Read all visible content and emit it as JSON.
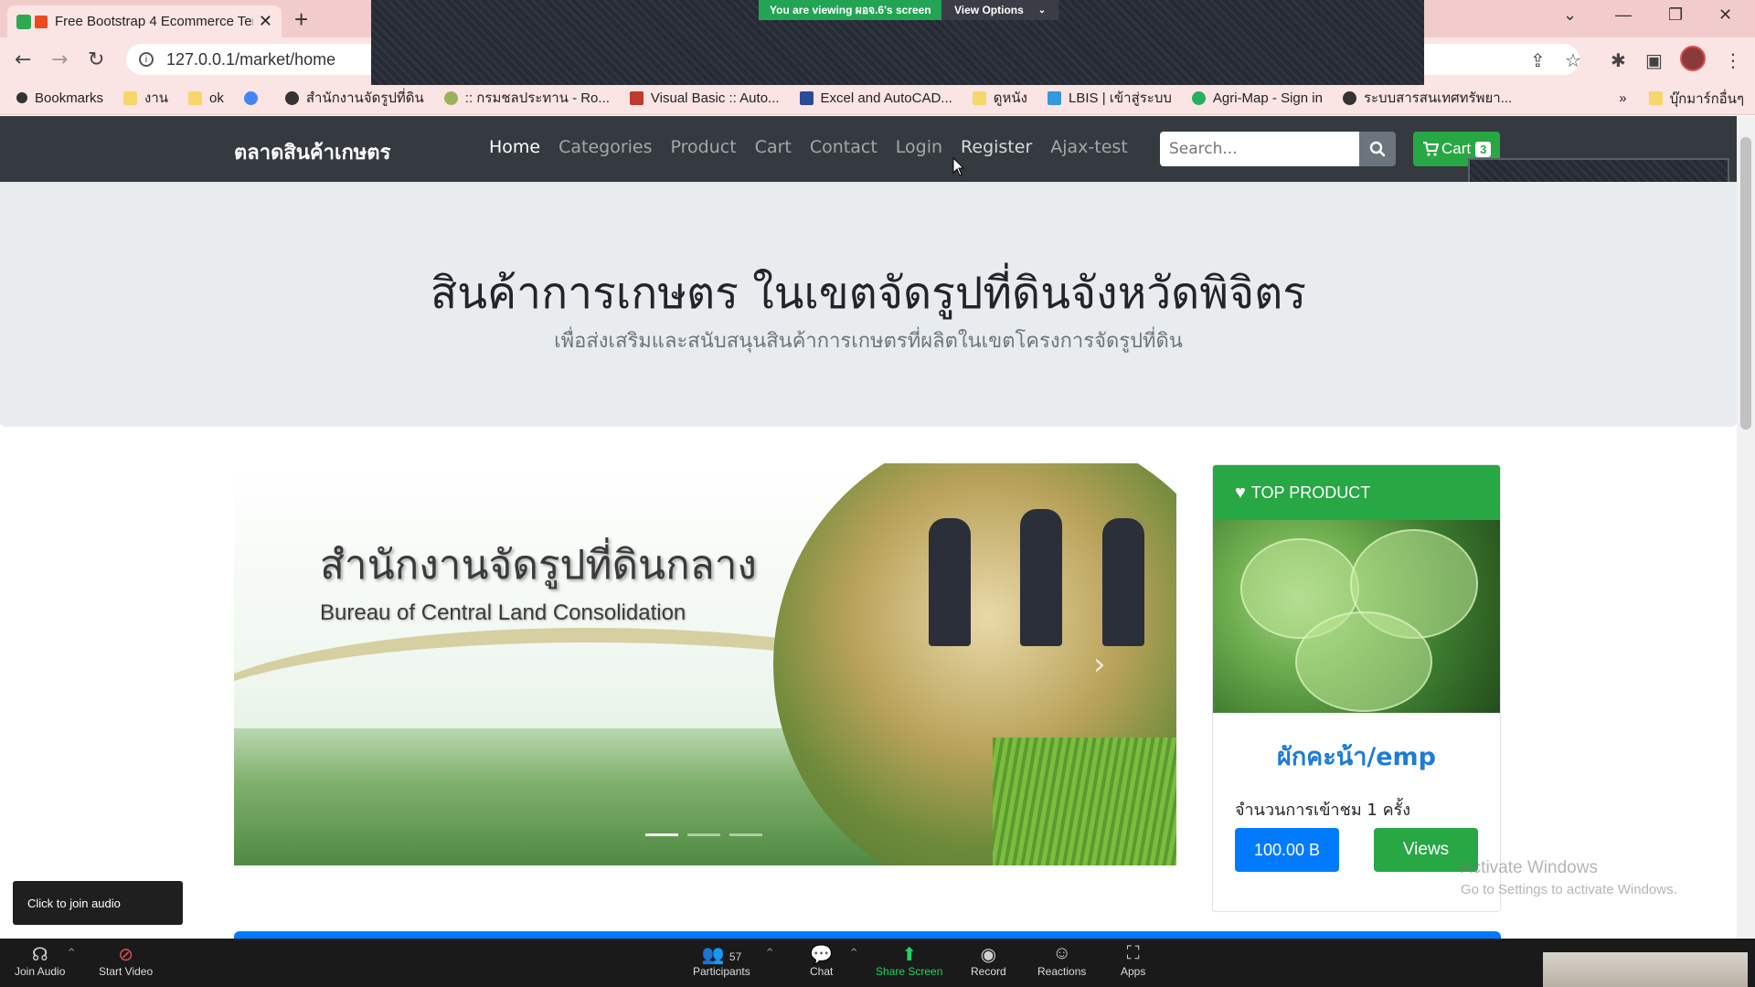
{
  "browser": {
    "tab_title": "Free Bootstrap 4 Ecommerce Template",
    "tab_close": "✕",
    "new_tab": "+",
    "url": "127.0.0.1/market/home",
    "bookmarks": [
      {
        "label": "Bookmarks",
        "color": "#333333"
      },
      {
        "label": "งาน",
        "color": "#f7d66a"
      },
      {
        "label": "ok",
        "color": "#f7d66a"
      },
      {
        "label": "",
        "color": "#4285f4"
      },
      {
        "label": "สำนักงานจัดรูปที่ดิน",
        "color": "#333333"
      },
      {
        "label": ":: กรมชลประทาน - Ro...",
        "color": "#9ab35a"
      },
      {
        "label": "Visual Basic :: Auto...",
        "color": "#c0392b"
      },
      {
        "label": "Excel and AutoCAD...",
        "color": "#2b4a9a"
      },
      {
        "label": "ดูหนัง",
        "color": "#f7d66a"
      },
      {
        "label": "LBIS | เข้าสู่ระบบ",
        "color": "#3498db"
      },
      {
        "label": "Agri-Map - Sign in",
        "color": "#27ae60"
      },
      {
        "label": "ระบบสารสนเทศทรัพยา...",
        "color": "#333333"
      }
    ],
    "bookmarks_more": "»",
    "bookmarks_other": "บุ๊กมาร์กอื่นๆ"
  },
  "zoom_share": {
    "viewing_text": "You are viewing ผอจ.6's screen",
    "view_options": "View Options"
  },
  "site": {
    "brand": "ตลาดสินค้าเกษตร",
    "nav": [
      {
        "label": "Home",
        "active": true
      },
      {
        "label": "Categories",
        "active": false
      },
      {
        "label": "Product",
        "active": false
      },
      {
        "label": "Cart",
        "active": false
      },
      {
        "label": "Contact",
        "active": false
      },
      {
        "label": "Login",
        "active": false
      },
      {
        "label": "Register",
        "active": false
      },
      {
        "label": "Ajax-test",
        "active": false
      }
    ],
    "search_placeholder": "Search...",
    "cart_label": "Cart",
    "cart_count": "3"
  },
  "jumbotron": {
    "title": "สินค้าการเกษตร ในเขตจัดรูปที่ดินจังหวัดพิจิตร",
    "subtitle": "เพื่อส่งเสริมและสนับสนุนสินค้าการเกษตรที่ผลิตในเขตโครงการจัดรูปที่ดิน"
  },
  "carousel": {
    "text_th": "สำนักงานจัดรูปที่ดินกลาง",
    "text_en": "Bureau of Central Land Consolidation",
    "active_slide": 1,
    "slide_count": 3
  },
  "top_product": {
    "header": "TOP PRODUCT",
    "name": "ผักคะน้า/emp",
    "views_text": "จำนวนการเข้าชม 1 ครั้ง",
    "price": "100.00 B",
    "views_button": "Views"
  },
  "windows_notice": {
    "line1": "Activate Windows",
    "line2": "Go to Settings to activate Windows."
  },
  "zoom_toolbar": {
    "tooltip": "Click to join audio",
    "items": [
      {
        "label": "Join Audio",
        "icon": "headphones-icon"
      },
      {
        "label": "Start Video",
        "icon": "video-off-icon"
      },
      {
        "label": "Participants",
        "icon": "participants-icon",
        "count": "57"
      },
      {
        "label": "Chat",
        "icon": "chat-icon"
      },
      {
        "label": "Share Screen",
        "icon": "share-screen-icon"
      },
      {
        "label": "Record",
        "icon": "record-icon"
      },
      {
        "label": "Reactions",
        "icon": "reactions-icon"
      },
      {
        "label": "Apps",
        "icon": "apps-icon"
      }
    ]
  }
}
